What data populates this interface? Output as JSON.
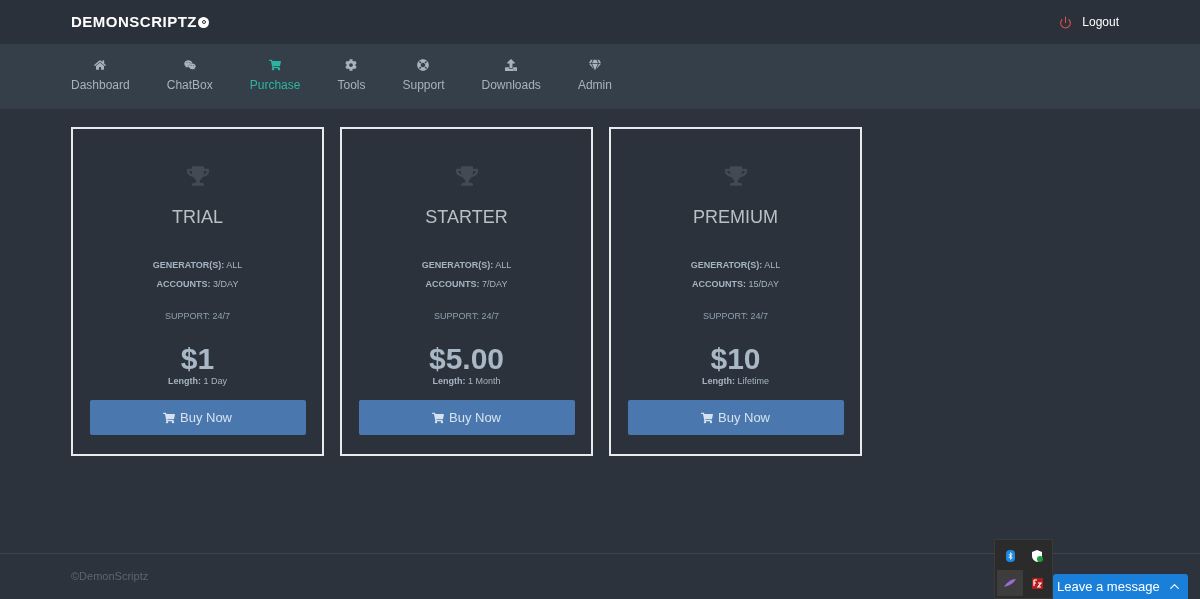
{
  "header": {
    "brand": "DEMONSCRIPTZ",
    "logout": "Logout"
  },
  "nav": [
    {
      "label": "Dashboard",
      "kind": "home",
      "selected": false
    },
    {
      "label": "ChatBox",
      "kind": "chat",
      "selected": false
    },
    {
      "label": "Purchase",
      "kind": "cart",
      "selected": true
    },
    {
      "label": "Tools",
      "kind": "gear",
      "selected": false
    },
    {
      "label": "Support",
      "kind": "lifebuoy",
      "selected": false
    },
    {
      "label": "Downloads",
      "kind": "upload",
      "selected": false
    },
    {
      "label": "Admin",
      "kind": "diamond",
      "selected": false
    }
  ],
  "plans": [
    {
      "name": "TRIAL",
      "features": [
        "**GENERATOR(S):** ALL",
        "**ACCOUNTS:** 3/DAY"
      ],
      "support": "SUPPORT: 24/7",
      "price": "$1",
      "length": "**Length:** 1 Day",
      "button": "Buy Now"
    },
    {
      "name": "STARTER",
      "features": [
        "**GENERATOR(S):** ALL",
        "**ACCOUNTS:** 7/DAY"
      ],
      "support": "SUPPORT: 24/7",
      "price": "$5.00",
      "length": "**Length:** 1 Month",
      "button": "Buy Now"
    },
    {
      "name": "PREMIUM",
      "features": [
        "**GENERATOR(S):** ALL",
        "**ACCOUNTS:** 15/DAY"
      ],
      "support": "SUPPORT: 24/7",
      "price": "$10",
      "length": "**Length:** Lifetime",
      "button": "Buy Now"
    }
  ],
  "footer": {
    "copyright": "©DemonScriptz"
  },
  "chat_widget": {
    "label": "Leave a message"
  }
}
